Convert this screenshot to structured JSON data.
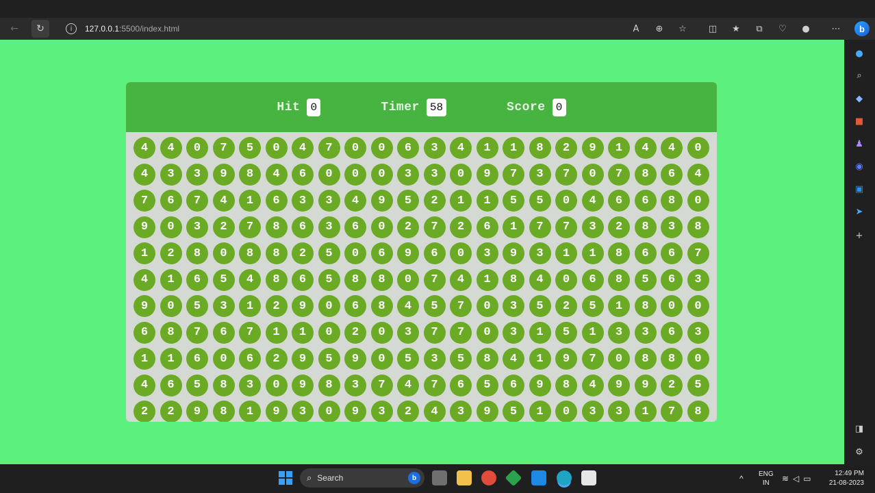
{
  "browser": {
    "url_host": "127.0.0.1",
    "url_path": ":5500/index.html",
    "bing_label": "b"
  },
  "game": {
    "hit_label": "Hit",
    "hit_value": "0",
    "timer_label": "Timer",
    "timer_value": "58",
    "score_label": "Score",
    "score_value": "0",
    "rows": [
      [
        "4",
        "4",
        "0",
        "7",
        "5",
        "0",
        "4",
        "7",
        "0",
        "0",
        "6",
        "3",
        "4",
        "1",
        "1",
        "8",
        "2",
        "9",
        "1",
        "4",
        "4",
        "0"
      ],
      [
        "4",
        "3",
        "3",
        "9",
        "8",
        "4",
        "6",
        "0",
        "0",
        "0",
        "3",
        "3",
        "0",
        "9",
        "7",
        "3",
        "7",
        "0",
        "7",
        "8",
        "6",
        "4"
      ],
      [
        "7",
        "6",
        "7",
        "4",
        "1",
        "6",
        "3",
        "3",
        "4",
        "9",
        "5",
        "2",
        "1",
        "1",
        "5",
        "5",
        "0",
        "4",
        "6",
        "6",
        "8",
        "0"
      ],
      [
        "9",
        "0",
        "3",
        "2",
        "7",
        "8",
        "6",
        "3",
        "6",
        "0",
        "2",
        "7",
        "2",
        "6",
        "1",
        "7",
        "7",
        "3",
        "2",
        "8",
        "3",
        "8"
      ],
      [
        "1",
        "2",
        "8",
        "0",
        "8",
        "8",
        "2",
        "5",
        "0",
        "6",
        "9",
        "6",
        "0",
        "3",
        "9",
        "3",
        "1",
        "1",
        "8",
        "6",
        "6",
        "7"
      ],
      [
        "4",
        "1",
        "6",
        "5",
        "4",
        "8",
        "6",
        "5",
        "8",
        "8",
        "0",
        "7",
        "4",
        "1",
        "8",
        "4",
        "0",
        "6",
        "8",
        "5",
        "6",
        "3"
      ],
      [
        "9",
        "0",
        "5",
        "3",
        "1",
        "2",
        "9",
        "0",
        "6",
        "8",
        "4",
        "5",
        "7",
        "0",
        "3",
        "5",
        "2",
        "5",
        "1",
        "8",
        "0",
        "0"
      ],
      [
        "6",
        "8",
        "7",
        "6",
        "7",
        "1",
        "1",
        "0",
        "2",
        "0",
        "3",
        "7",
        "7",
        "0",
        "3",
        "1",
        "5",
        "1",
        "3",
        "3",
        "6",
        "3"
      ],
      [
        "1",
        "1",
        "6",
        "0",
        "6",
        "2",
        "9",
        "5",
        "9",
        "0",
        "5",
        "3",
        "5",
        "8",
        "4",
        "1",
        "9",
        "7",
        "0",
        "8",
        "8",
        "0"
      ],
      [
        "4",
        "6",
        "5",
        "8",
        "3",
        "0",
        "9",
        "8",
        "3",
        "7",
        "4",
        "7",
        "6",
        "5",
        "6",
        "9",
        "8",
        "4",
        "9",
        "9",
        "2",
        "5"
      ],
      [
        "2",
        "2",
        "9",
        "8",
        "1",
        "9",
        "3",
        "0",
        "9",
        "3",
        "2",
        "4",
        "3",
        "9",
        "5",
        "1",
        "0",
        "3",
        "3",
        "1",
        "7",
        "8"
      ]
    ]
  },
  "taskbar": {
    "search_label": "Search",
    "lang_line1": "ENG",
    "lang_line2": "IN",
    "time": "12:49 PM",
    "date": "21-08-2023"
  }
}
